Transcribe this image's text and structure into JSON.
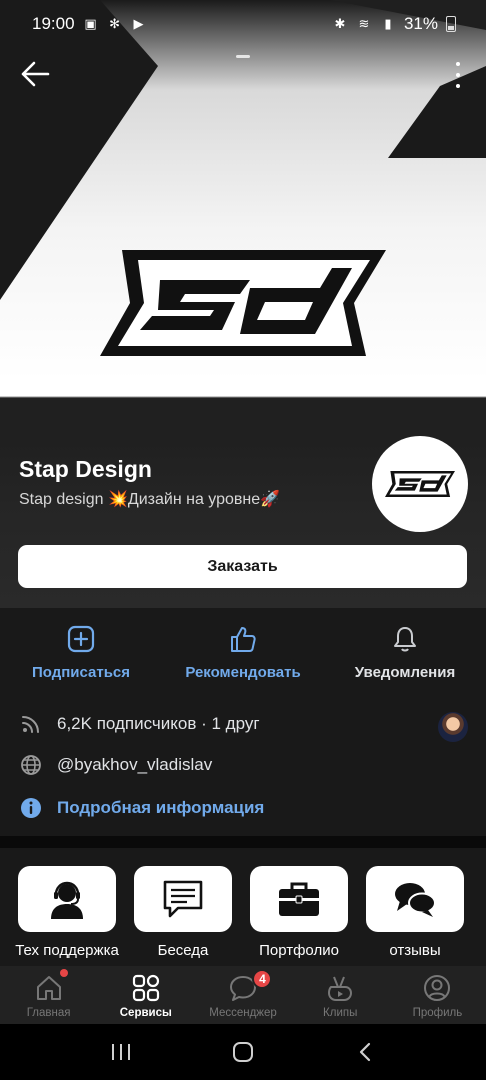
{
  "status_bar": {
    "time": "19:00",
    "battery": "31%"
  },
  "group": {
    "name": "Stap Design",
    "status": "Stap design 💥Дизайн на уровне🚀",
    "order_button": "Заказать"
  },
  "actions": [
    {
      "label": "Подписаться",
      "icon": "plus-square-icon"
    },
    {
      "label": "Рекомендовать",
      "icon": "thumbs-up-icon"
    },
    {
      "label": "Уведомления",
      "icon": "bell-icon"
    }
  ],
  "info": {
    "followers": "6,2K подписчиков · 1 друг",
    "site": "@byakhov_vladislav",
    "details_link": "Подробная информация"
  },
  "services": [
    {
      "label": "Тех поддержка",
      "icon": "headset-icon"
    },
    {
      "label": "Беседа",
      "icon": "chat-icon"
    },
    {
      "label": "Портфолио",
      "icon": "briefcase-icon"
    },
    {
      "label": "отзывы",
      "icon": "speech-bubbles-icon"
    }
  ],
  "tabbar": {
    "tabs": [
      {
        "label": "Главная",
        "icon": "home-icon",
        "active": false
      },
      {
        "label": "Сервисы",
        "icon": "services-grid-icon",
        "active": true
      },
      {
        "label": "Мессенджер",
        "icon": "messenger-icon",
        "active": false,
        "badge": "4"
      },
      {
        "label": "Клипы",
        "icon": "clips-icon",
        "active": false
      },
      {
        "label": "Профиль",
        "icon": "profile-icon",
        "active": false
      }
    ]
  },
  "colors": {
    "accent": "#71aaeb",
    "background": "#191919",
    "badge": "#e64646"
  }
}
